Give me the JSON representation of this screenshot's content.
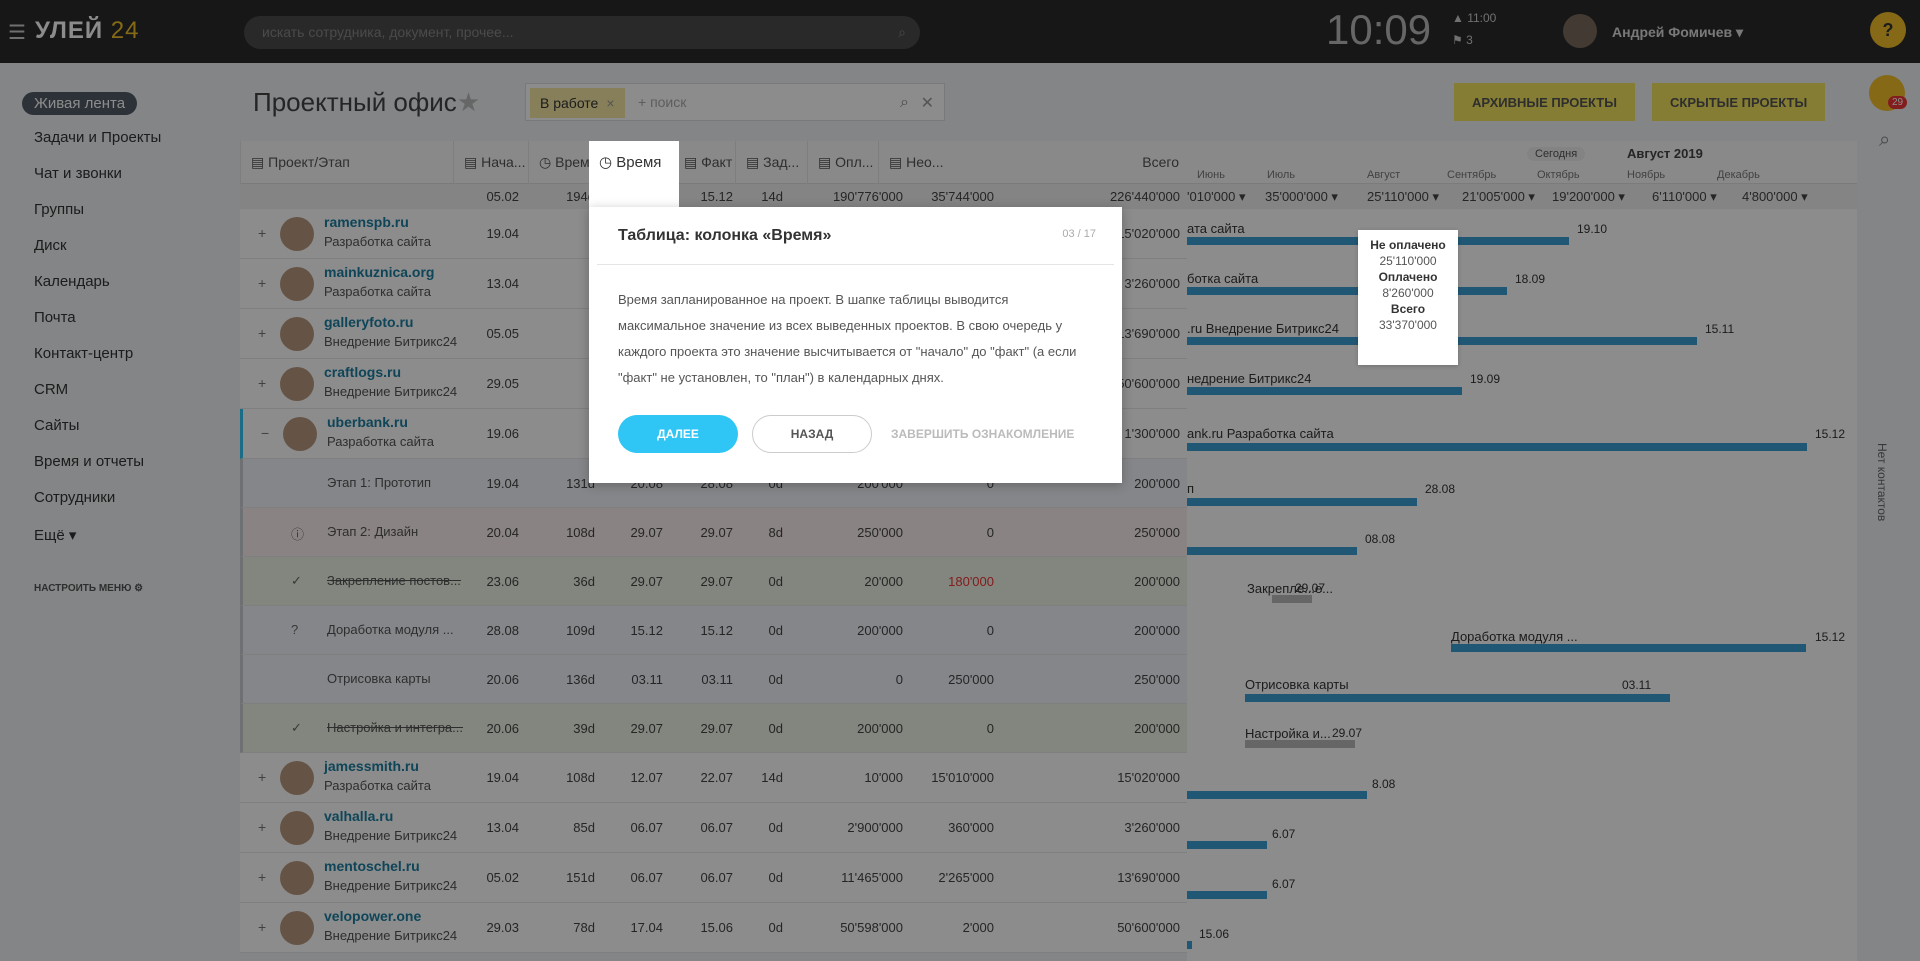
{
  "topbar": {
    "logo": "УЛЕЙ",
    "logo_num": "24",
    "search_placeholder": "искать сотрудника, документ, прочее...",
    "clock": "10:09",
    "alarm": "▲ 11:00",
    "flags": "⚑ 3",
    "user": "Андрей Фомичев ▾",
    "help": "?"
  },
  "nav": {
    "items": [
      "Живая лента",
      "Задачи и Проекты",
      "Чат и звонки",
      "Группы",
      "Диск",
      "Календарь",
      "Почта",
      "Контакт-центр",
      "CRM",
      "Сайты",
      "Время и отчеты",
      "Сотрудники",
      "Ещё ▾"
    ],
    "settings": "НАСТРОИТЬ МЕНЮ"
  },
  "header": {
    "title": "Проектный офис",
    "star": "★",
    "filter_chip": "В работе",
    "filter_placeholder": "+ поиск",
    "btn_archive": "АРХИВНЫЕ ПРОЕКТЫ",
    "btn_hidden": "СКРЫТЫЕ ПРОЕКТЫ"
  },
  "table": {
    "columns": [
      "Проект/Этап",
      "Нача...",
      "Время",
      "План",
      "Факт",
      "Зад...",
      "Опл...",
      "Нео...",
      "Всего"
    ],
    "totals": [
      "05.02",
      "194d",
      "15.12",
      "15.12",
      "14d",
      "190'776'000",
      "35'744'000",
      "226'440'000"
    ],
    "rows": [
      {
        "name": "ramenspb.ru",
        "sub": "Разработка сайта",
        "start": "19.04",
        "total": "15'020'000"
      },
      {
        "name": "mainkuznica.org",
        "sub": "Разработка сайта",
        "start": "13.04",
        "total": "3'260'000"
      },
      {
        "name": "galleryfoto.ru",
        "sub": "Внедрение Битрикс24",
        "start": "05.05",
        "total": "13'690'000"
      },
      {
        "name": "craftlogs.ru",
        "sub": "Внедрение Битрикс24",
        "start": "29.05",
        "total": "50'600'000"
      },
      {
        "name": "uberbank.ru",
        "sub": "Разработка сайта",
        "start": "19.06",
        "total": "1'300'000"
      }
    ],
    "stages": [
      {
        "icon": "",
        "name": "Этап 1: Прототип",
        "start": "19.04",
        "time": "131d",
        "plan": "20.08",
        "fact": "28.08",
        "tasks": "0d",
        "paid": "200'000",
        "unpaid": "0",
        "total": "200'000"
      },
      {
        "icon": "ⓘ",
        "name": "Этап 2: Дизайн",
        "start": "20.04",
        "time": "108d",
        "plan": "29.07",
        "fact": "29.07",
        "tasks": "8d",
        "paid": "250'000",
        "unpaid": "0",
        "total": "250'000"
      },
      {
        "icon": "✓",
        "name": "Закрепление постов...",
        "start": "23.06",
        "time": "36d",
        "plan": "29.07",
        "fact": "29.07",
        "tasks": "0d",
        "paid": "20'000",
        "unpaid": "180'000",
        "total": "200'000"
      },
      {
        "icon": "?",
        "name": "Доработка модуля ...",
        "start": "28.08",
        "time": "109d",
        "plan": "15.12",
        "fact": "15.12",
        "tasks": "0d",
        "paid": "200'000",
        "unpaid": "0",
        "total": "200'000"
      },
      {
        "icon": "",
        "name": "Отрисовка карты",
        "start": "20.06",
        "time": "136d",
        "plan": "03.11",
        "fact": "03.11",
        "tasks": "0d",
        "paid": "0",
        "unpaid": "250'000",
        "total": "250'000"
      },
      {
        "icon": "✓",
        "name": "Настройка и интегра...",
        "start": "20.06",
        "time": "39d",
        "plan": "29.07",
        "fact": "29.07",
        "tasks": "0d",
        "paid": "200'000",
        "unpaid": "0",
        "total": "200'000"
      }
    ],
    "rows2": [
      {
        "name": "jamessmith.ru",
        "sub": "Разработка сайта",
        "start": "19.04",
        "time": "108d",
        "plan": "12.07",
        "fact": "22.07",
        "tasks": "14d",
        "paid": "10'000",
        "unpaid": "15'010'000",
        "total": "15'020'000"
      },
      {
        "name": "valhalla.ru",
        "sub": "Внедрение Битрикс24",
        "start": "13.04",
        "time": "85d",
        "plan": "06.07",
        "fact": "06.07",
        "tasks": "0d",
        "paid": "2'900'000",
        "unpaid": "360'000",
        "total": "3'260'000"
      },
      {
        "name": "mentoschel.ru",
        "sub": "Внедрение Битрикс24",
        "start": "05.02",
        "time": "151d",
        "plan": "06.07",
        "fact": "06.07",
        "tasks": "0d",
        "paid": "11'465'000",
        "unpaid": "2'265'000",
        "total": "13'690'000"
      },
      {
        "name": "velopower.one",
        "sub": "Внедрение Битрикс24",
        "start": "29.03",
        "time": "78d",
        "plan": "17.04",
        "fact": "15.06",
        "tasks": "0d",
        "paid": "50'598'000",
        "unpaid": "2'000",
        "total": "50'600'000"
      }
    ]
  },
  "gantt": {
    "today": "Сегодня",
    "period": "Август 2019",
    "months": [
      "Июнь",
      "Июль",
      "Август",
      "Сентябрь",
      "Октябрь",
      "Ноябрь",
      "Декабрь"
    ],
    "month_totals": [
      "'010'000 ▾",
      "35'000'000 ▾",
      "25'110'000 ▾",
      "21'005'000 ▾",
      "19'200'000 ▾",
      "6'110'000 ▾",
      "4'800'000 ▾"
    ],
    "labels": [
      "ата сайта",
      "ботка сайта",
      ".ru Внедрение Битрикс24",
      "недрение Битрикс24",
      "ank.ru Разработка сайта",
      "п",
      "",
      "Закрепле...е...",
      "Доработка модуля ...",
      "Отрисовка карты",
      "Настройка и..."
    ],
    "dates": [
      "19.10",
      "18.09",
      "15.11",
      "19.09",
      "15.12",
      "28.08",
      "08.08",
      "29.07",
      "15.12",
      "03.11",
      "29.07",
      "8.08",
      "6.07",
      "6.07",
      "15.06"
    ],
    "tooltip": {
      "unpaid_label": "Не оплачено",
      "unpaid": "25'110'000",
      "paid_label": "Оплачено",
      "paid": "8'260'000",
      "total_label": "Всего",
      "total": "33'370'000"
    },
    "side_text": "Нет контактов"
  },
  "popup": {
    "title": "Таблица: колонка «Время»",
    "page": "03 / 17",
    "body": "Время запланированное на проект. В шапке таблицы выводится максимальное значение из всех выведенных проектов. В свою очередь у каждого проекта это значение высчитывается от \"начало\" до \"факт\" (а если \"факт\" не установлен, то \"план\") в календарных днях.",
    "next": "ДАЛЕЕ",
    "back": "НАЗАД",
    "finish": "ЗАВЕРШИТЬ ОЗНАКОМЛЕНИЕ"
  },
  "badge": "29"
}
